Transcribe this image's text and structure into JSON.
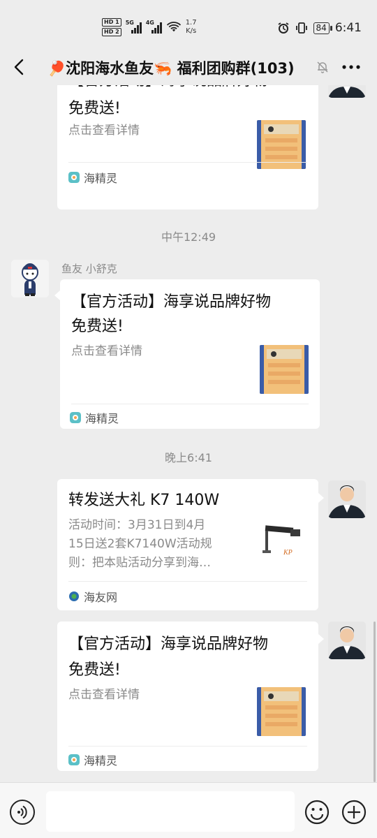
{
  "status": {
    "hd1": "HD 1",
    "hd2": "HD 2",
    "net1": "5G",
    "net2": "4G",
    "speed_value": "1.7",
    "speed_unit": "K/s",
    "battery": "84",
    "time": "6:41"
  },
  "header": {
    "title": "🏓沈阳海水鱼友🦐 福利团购群(103)"
  },
  "messages": [
    {
      "title_line1": "【官方活动】海享说品牌好物",
      "title_line2": "免费送!",
      "desc": "点击查看详情",
      "source": "海精灵"
    },
    {
      "time": "中午12:49",
      "sender": "鱼友 小舒克",
      "title_line1": "【官方活动】海享说品牌好物",
      "title_line2": "免费送!",
      "desc": "点击查看详情",
      "source": "海精灵"
    },
    {
      "time": "晚上6:41",
      "title": "转发送大礼 K7 140W",
      "desc_line1": "活动时间：3月31日到4月",
      "desc_line2": "15日送2套K7140W活动规",
      "desc_line3": "则：把本贴活动分享到海…",
      "source": "海友网"
    },
    {
      "title_line1": "【官方活动】海享说品牌好物",
      "title_line2": "免费送!",
      "desc": "点击查看详情",
      "source": "海精灵"
    }
  ],
  "colors": {
    "background": "#ededed",
    "card": "#ffffff",
    "muted_text": "#8a8a8a",
    "input_bar": "#f7f7f7"
  },
  "icons": {
    "back": "chevron-left-icon",
    "mute": "bell-off-icon",
    "more": "more-dots-icon",
    "voice": "voice-icon",
    "emoji": "smile-icon",
    "plus": "plus-icon",
    "source_haijingling": "haijingling-icon",
    "source_haiyouwang": "haiyouwang-icon"
  }
}
